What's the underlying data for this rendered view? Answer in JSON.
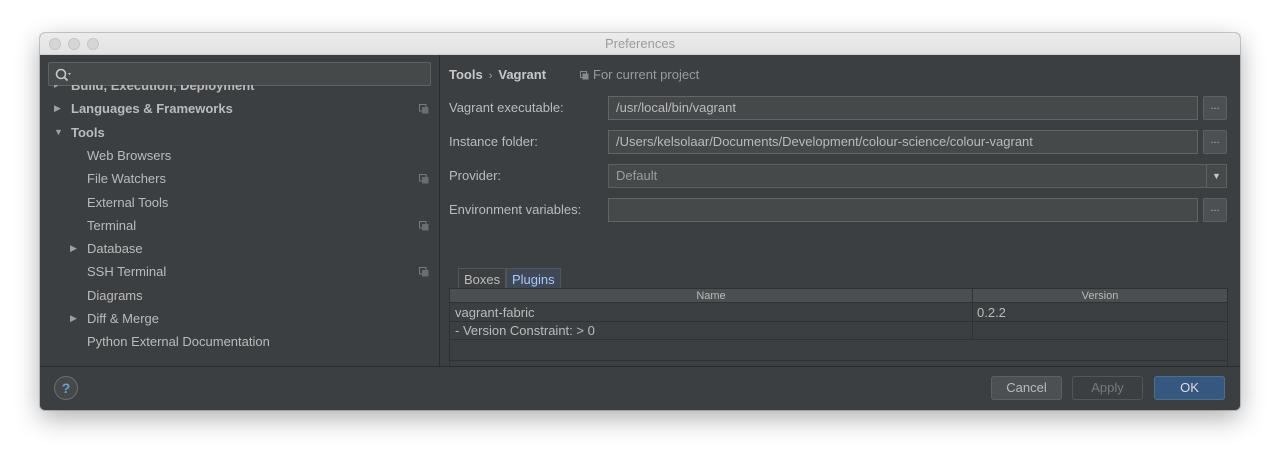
{
  "window": {
    "title": "Preferences"
  },
  "search": {
    "placeholder": ""
  },
  "sidebar": {
    "items": [
      {
        "label": "Build, Execution, Deployment",
        "level": 0,
        "arrow": "▸",
        "bold": true,
        "copy": false
      },
      {
        "label": "Languages & Frameworks",
        "level": 0,
        "arrow": "▶",
        "bold": true,
        "copy": true
      },
      {
        "label": "Tools",
        "level": 0,
        "arrow": "▼",
        "bold": true,
        "copy": false
      },
      {
        "label": "Web Browsers",
        "level": 1,
        "arrow": "",
        "bold": false,
        "copy": false
      },
      {
        "label": "File Watchers",
        "level": 1,
        "arrow": "",
        "bold": false,
        "copy": true
      },
      {
        "label": "External Tools",
        "level": 1,
        "arrow": "",
        "bold": false,
        "copy": false
      },
      {
        "label": "Terminal",
        "level": 1,
        "arrow": "",
        "bold": false,
        "copy": true
      },
      {
        "label": "Database",
        "level": 1,
        "arrow": "▶",
        "bold": false,
        "copy": false
      },
      {
        "label": "SSH Terminal",
        "level": 1,
        "arrow": "",
        "bold": false,
        "copy": true
      },
      {
        "label": "Diagrams",
        "level": 1,
        "arrow": "",
        "bold": false,
        "copy": false
      },
      {
        "label": "Diff & Merge",
        "level": 1,
        "arrow": "▶",
        "bold": false,
        "copy": false
      },
      {
        "label": "Python External Documentation",
        "level": 1,
        "arrow": "",
        "bold": false,
        "copy": false
      }
    ]
  },
  "breadcrumb": {
    "parent": "Tools",
    "separator": "›",
    "current": "Vagrant"
  },
  "project_scope": "For current project",
  "form": {
    "executable_label": "Vagrant executable:",
    "executable_value": "/usr/local/bin/vagrant",
    "instance_label": "Instance folder:",
    "instance_value": "/Users/kelsolaar/Documents/Development/colour-science/colour-vagrant",
    "provider_label": "Provider:",
    "provider_value": "Default",
    "env_label": "Environment variables:",
    "env_value": "",
    "browse_label": "..."
  },
  "tabs": {
    "boxes": "Boxes",
    "plugins": "Plugins"
  },
  "plugins_table": {
    "headers": {
      "name": "Name",
      "version": "Version"
    },
    "rows": [
      {
        "name": "vagrant-fabric",
        "version": "0.2.2"
      },
      {
        "name": "- Version Constraint: > 0",
        "version": ""
      }
    ]
  },
  "toolbar": {
    "add": "+",
    "remove": "−",
    "refresh": "↻",
    "delete": "🗑"
  },
  "footer": {
    "help": "?",
    "cancel": "Cancel",
    "apply": "Apply",
    "ok": "OK"
  },
  "colors": {
    "bg": "#3c3f41",
    "field": "#45494a",
    "accent": "#365880",
    "text": "#bbbbbb"
  }
}
